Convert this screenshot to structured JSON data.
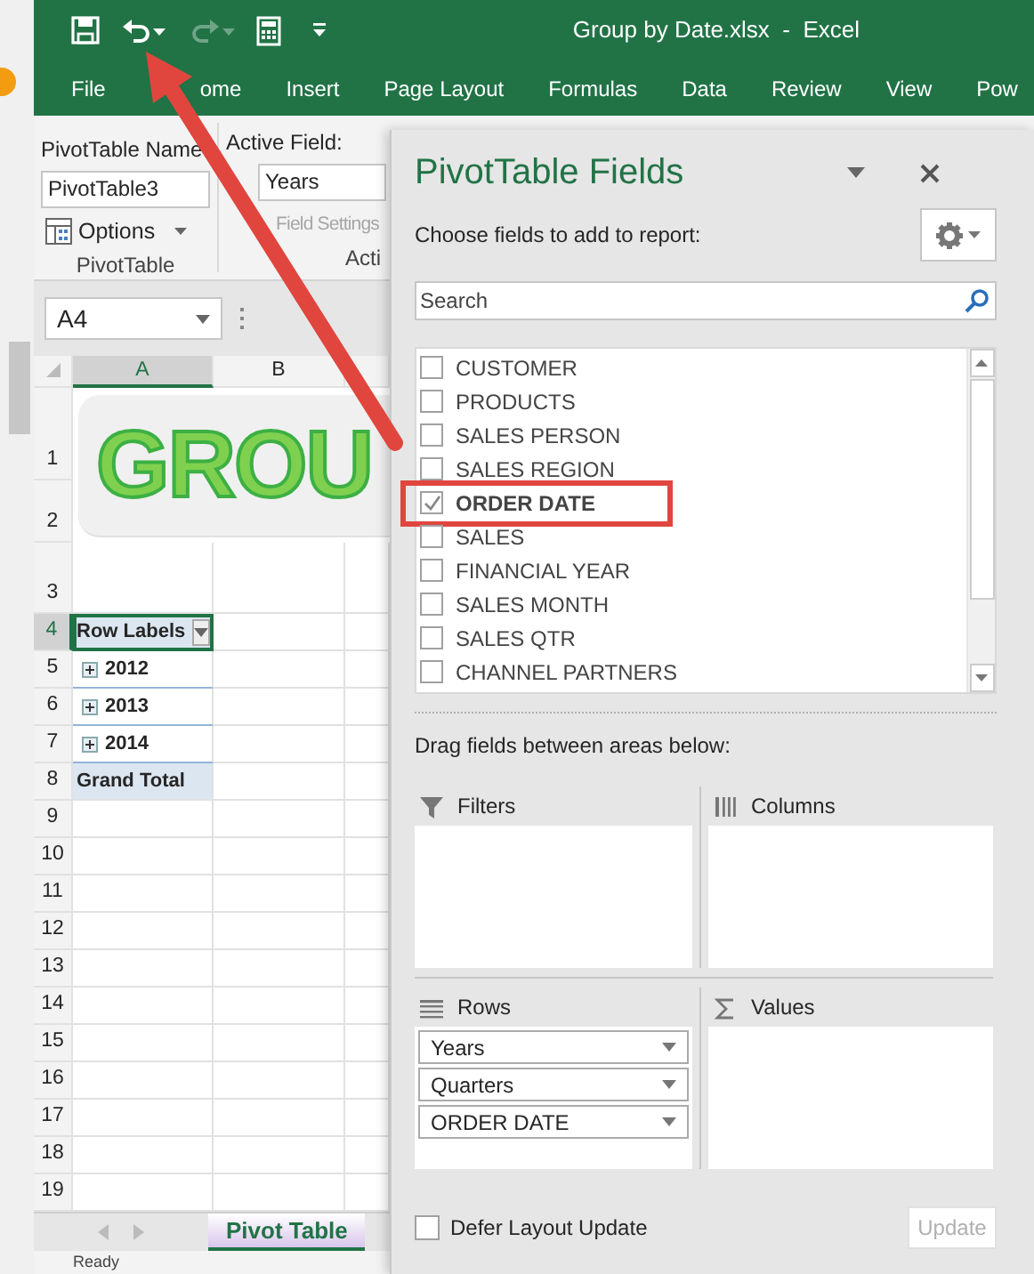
{
  "window": {
    "title": "Group by Date.xlsx  -  Excel"
  },
  "quick_access": [
    {
      "kind": "save",
      "disabled": false
    },
    {
      "kind": "undo",
      "disabled": false
    },
    {
      "kind": "redo",
      "disabled": true
    },
    {
      "kind": "calculator",
      "disabled": false
    },
    {
      "kind": "customize",
      "disabled": false
    }
  ],
  "ribbon_tabs": [
    "File",
    "ome",
    "Insert",
    "Page Layout",
    "Formulas",
    "Data",
    "Review",
    "View",
    "Pow"
  ],
  "ribbon": {
    "pivottable_name": {
      "label": "PivotTable Name",
      "value": "PivotTable3"
    },
    "options_button": "Options",
    "pivottable_group": "PivotTable",
    "active_field": {
      "label": "Active Field:",
      "value": "Years"
    },
    "field_settings": {
      "label": "Field Settings",
      "disabled": true
    },
    "active_field_group": "Acti"
  },
  "formula_bar": {
    "name_box": "A4"
  },
  "sheet": {
    "columns": [
      {
        "label": "A",
        "selected": true
      },
      {
        "label": "B",
        "selected": false
      }
    ],
    "rows": [
      {
        "label": "1",
        "selected": false
      },
      {
        "label": "2",
        "selected": false
      },
      {
        "label": "3",
        "selected": false
      },
      {
        "label": "4",
        "selected": true
      },
      {
        "label": "5",
        "selected": false
      },
      {
        "label": "6",
        "selected": false
      },
      {
        "label": "7",
        "selected": false
      },
      {
        "label": "8",
        "selected": false
      },
      {
        "label": "9",
        "selected": false
      },
      {
        "label": "10",
        "selected": false
      },
      {
        "label": "11",
        "selected": false
      },
      {
        "label": "12",
        "selected": false
      },
      {
        "label": "13",
        "selected": false
      },
      {
        "label": "14",
        "selected": false
      },
      {
        "label": "15",
        "selected": false
      },
      {
        "label": "16",
        "selected": false
      },
      {
        "label": "17",
        "selected": false
      },
      {
        "label": "18",
        "selected": false
      },
      {
        "label": "19",
        "selected": false
      }
    ],
    "banner": "GROU",
    "pivot": {
      "header": "Row Labels",
      "items": [
        {
          "label": "2012",
          "expanded": false
        },
        {
          "label": "2013",
          "expanded": false
        },
        {
          "label": "2014",
          "expanded": false
        }
      ],
      "total": "Grand Total"
    }
  },
  "sheet_tabs": [
    {
      "label": "Pivot Table",
      "selected": true
    }
  ],
  "status_bar": "Ready",
  "field_pane": {
    "title": "PivotTable Fields",
    "subtitle": "Choose fields to add to report:",
    "search": {
      "placeholder": "Search"
    },
    "fields": [
      {
        "label": "CUSTOMER",
        "checked": false,
        "highlighted": false
      },
      {
        "label": "PRODUCTS",
        "checked": false,
        "highlighted": false
      },
      {
        "label": "SALES PERSON",
        "checked": false,
        "highlighted": false
      },
      {
        "label": "SALES REGION",
        "checked": false,
        "highlighted": false
      },
      {
        "label": "ORDER DATE",
        "checked": true,
        "highlighted": true
      },
      {
        "label": "SALES",
        "checked": false,
        "highlighted": false
      },
      {
        "label": "FINANCIAL YEAR",
        "checked": false,
        "highlighted": false
      },
      {
        "label": "SALES MONTH",
        "checked": false,
        "highlighted": false
      },
      {
        "label": "SALES QTR",
        "checked": false,
        "highlighted": false
      },
      {
        "label": "CHANNEL PARTNERS",
        "checked": false,
        "highlighted": false
      }
    ],
    "areas_hint": "Drag fields between areas below:",
    "areas": [
      {
        "kind": "filters",
        "label": "Filters"
      },
      {
        "kind": "columns",
        "label": "Columns"
      },
      {
        "kind": "rows",
        "label": "Rows",
        "items": [
          "Years",
          "Quarters",
          "ORDER DATE"
        ]
      },
      {
        "kind": "values",
        "label": "Values"
      }
    ],
    "defer": {
      "label": "Defer Layout Update",
      "checked": false
    },
    "update_button": {
      "label": "Update",
      "disabled": true
    }
  }
}
